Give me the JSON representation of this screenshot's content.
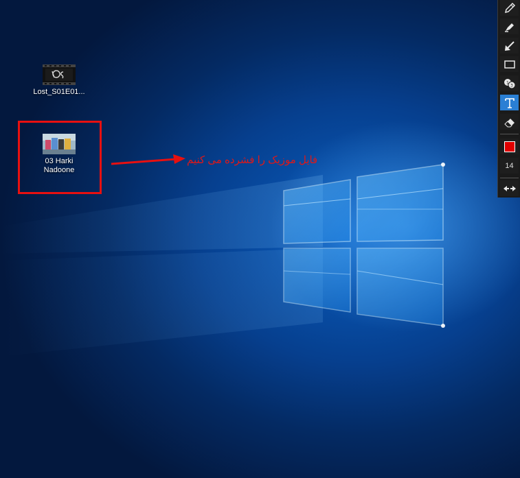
{
  "desktop": {
    "icons": [
      {
        "label": "Lost_S01E01...",
        "thumbnail": "video-file-icon"
      },
      {
        "label": "03 Harki\nNadoone",
        "thumbnail": "media-thumbnail-icon"
      }
    ]
  },
  "annotation": {
    "text": "فایل موزیک را فشرده می کنیم",
    "color": "#e01818"
  },
  "toolbar": {
    "tools": [
      {
        "name": "pencil",
        "icon": "pencil-icon"
      },
      {
        "name": "marker",
        "icon": "marker-icon"
      },
      {
        "name": "arrow",
        "icon": "arrow-icon"
      },
      {
        "name": "rectangle",
        "icon": "rectangle-icon"
      },
      {
        "name": "counter",
        "icon": "numbered-circles-icon"
      },
      {
        "name": "text",
        "icon": "text-tool-icon",
        "active": true
      },
      {
        "name": "eraser",
        "icon": "eraser-icon"
      }
    ],
    "color": "#e00000",
    "font_size": "14",
    "extra": "move-arrows-icon"
  }
}
